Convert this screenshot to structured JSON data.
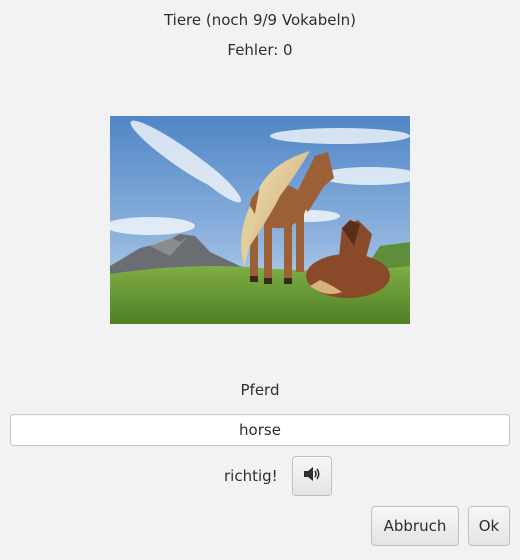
{
  "header": {
    "title": "Tiere (noch 9/9 Vokabeln)",
    "errors": "Fehler: 0"
  },
  "image": {
    "subject": "horses-on-mountain-meadow"
  },
  "quiz": {
    "word": "Pferd",
    "answer_value": "horse",
    "feedback": "richtig!"
  },
  "icons": {
    "sound": "speaker-icon"
  },
  "buttons": {
    "cancel": "Abbruch",
    "ok": "Ok"
  }
}
